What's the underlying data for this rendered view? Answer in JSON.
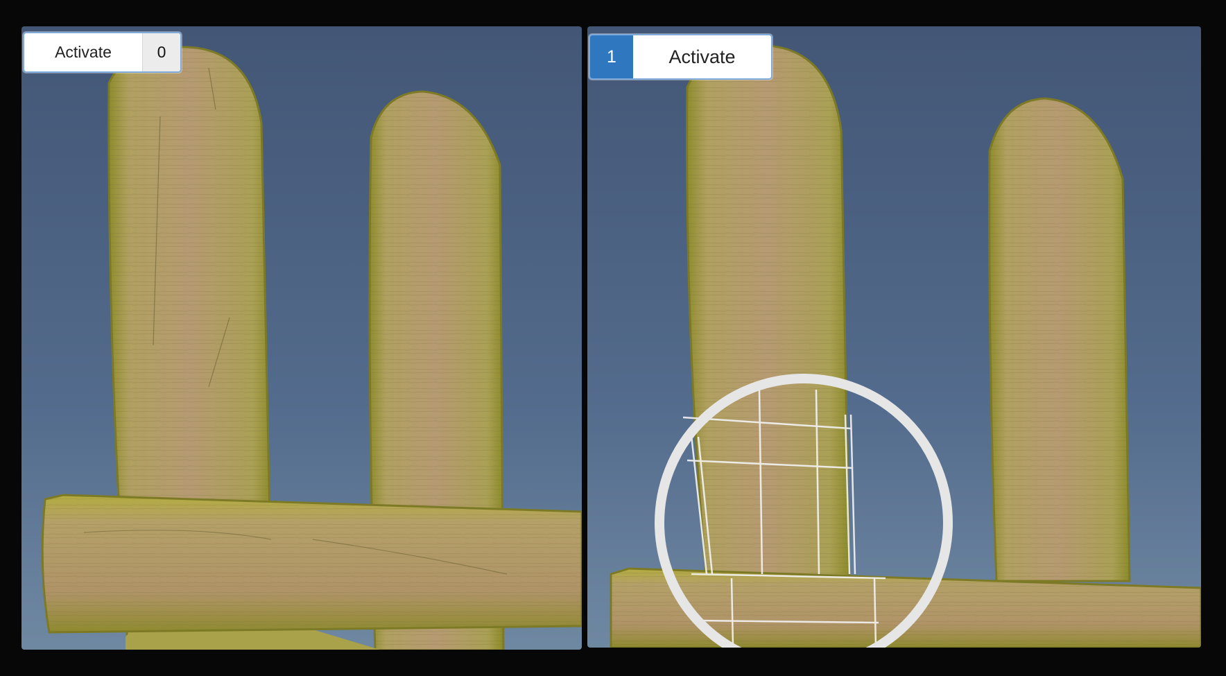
{
  "panels": {
    "left": {
      "button_label": "Activate",
      "count": "0"
    },
    "right": {
      "count": "1",
      "button_label": "Activate"
    }
  },
  "colors": {
    "sky_top": "#445878",
    "sky_bottom": "#6b84a0",
    "wood_light": "#b59a6a",
    "wood_moss": "#a8a83a",
    "wireframe": "#ffffff",
    "accent_blue": "#2f78bf",
    "frame": "#070707"
  },
  "icons": {
    "magnifier": "magnifier-lens-icon"
  }
}
